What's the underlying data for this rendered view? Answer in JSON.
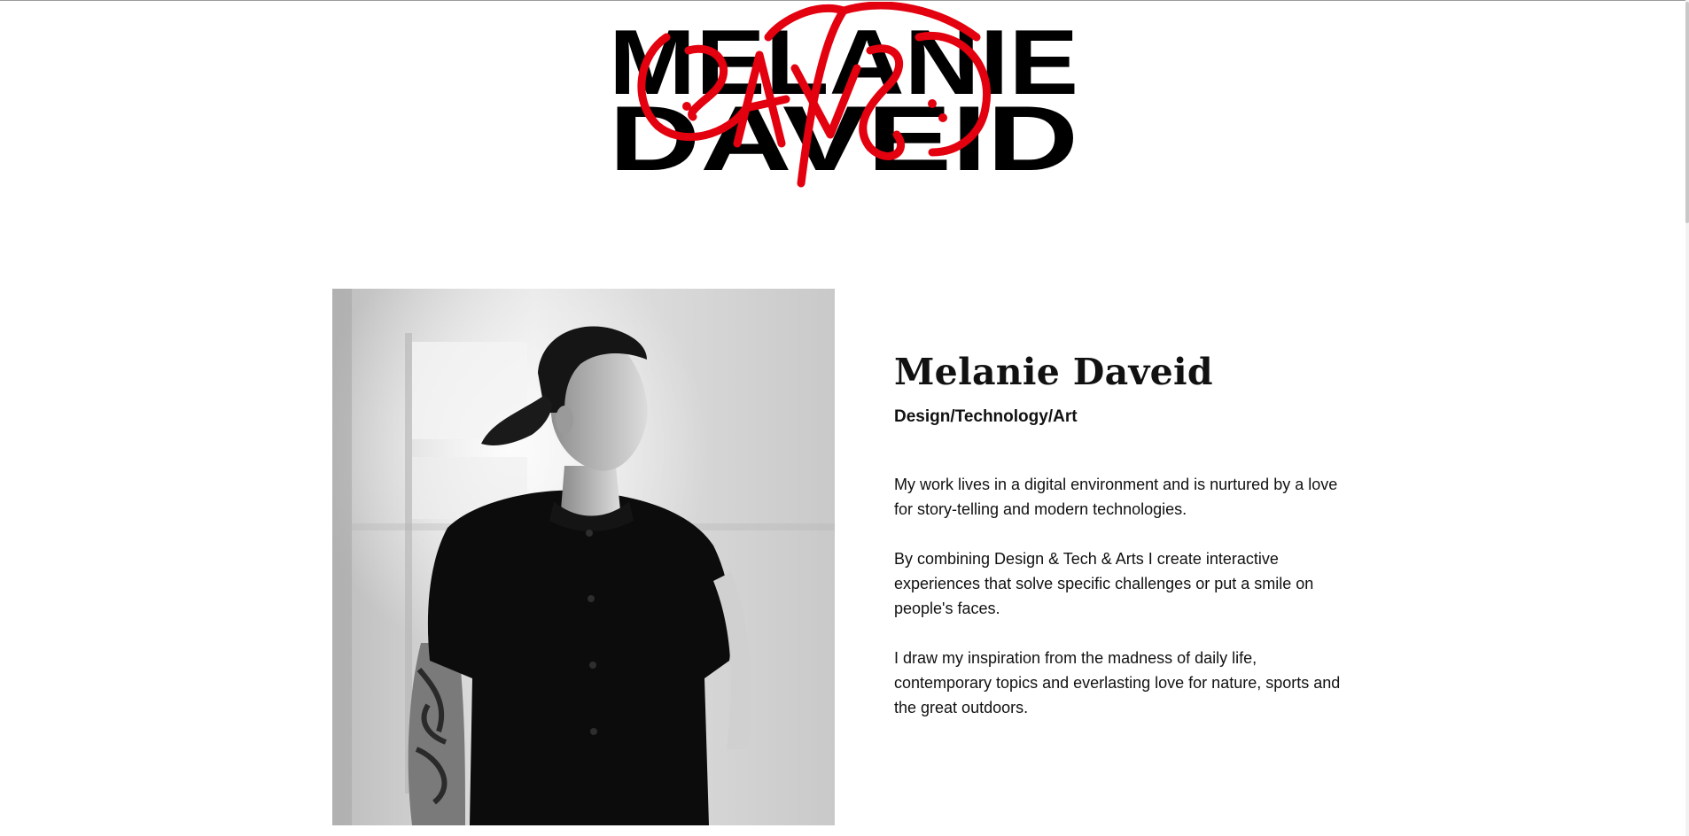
{
  "logo": {
    "wordmark_line1": "MELANIE",
    "wordmark_line2": "DAVEID",
    "ink_color": "#000000",
    "scribble_color": "#e3000f"
  },
  "portrait": {
    "icon": "portrait-photo"
  },
  "bio": {
    "name": "Melanie Daveid",
    "tagline": "Design/Technology/Art",
    "paragraphs": [
      "My work lives in a digital environment and is nurtured by a love for story-telling and modern technologies.",
      "By combining Design & Tech & Arts I create interactive experiences that solve specific challenges or put a smile on people's faces.",
      "I draw my inspiration from the madness of daily life, contemporary topics and everlasting love for nature, sports and the great outdoors."
    ]
  }
}
